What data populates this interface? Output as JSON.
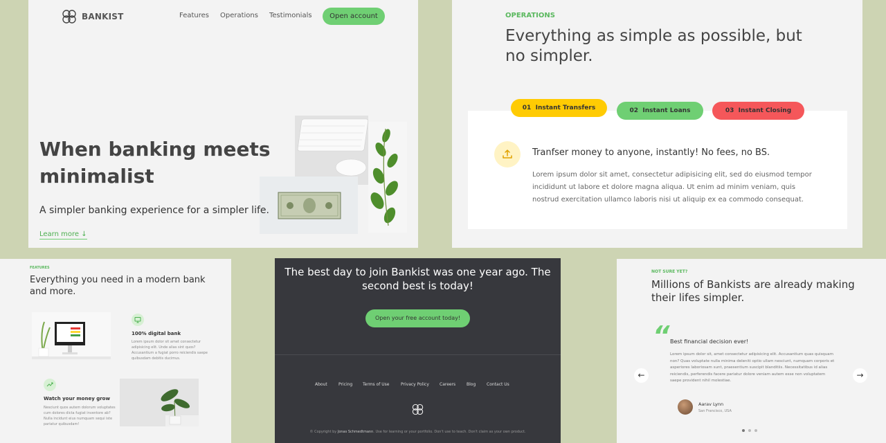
{
  "colors": {
    "background": "#cdd4b3",
    "panel": "#f3f3f3",
    "accent_green": "#6fcf73",
    "dark": "#37383d",
    "tab_yellow": "#ffcb03",
    "tab_green": "#6fcf73",
    "tab_red": "#f5575a"
  },
  "hero": {
    "brand": "BANKIST",
    "nav": [
      "Features",
      "Operations",
      "Testimonials"
    ],
    "cta": "Open account",
    "headline_word1": "When",
    "headline_highlight1": "banking",
    "headline_word2": "meets",
    "headline_highlight2": "minimalist",
    "subtitle": "A simpler banking experience for a simpler life.",
    "learn_more": "Learn more ↓"
  },
  "operations": {
    "label": "OPERATIONS",
    "title": "Everything as simple as possible, but no simpler.",
    "tabs": [
      {
        "num": "01",
        "label": "Instant Transfers"
      },
      {
        "num": "02",
        "label": "Instant Loans"
      },
      {
        "num": "03",
        "label": "Instant Closing"
      }
    ],
    "active_tab": "Instant Transfers",
    "heading": "Tranfser money to anyone, instantly! No fees, no BS.",
    "body": "Lorem ipsum dolor sit amet, consectetur adipisicing elit, sed do eiusmod tempor incididunt ut labore et dolore magna aliqua. Ut enim ad minim veniam, quis nostrud exercitation ullamco laboris nisi ut aliquip ex ea commodo consequat."
  },
  "features": {
    "label": "FEATURES",
    "title": "Everything you need in a modern bank and more.",
    "items": [
      {
        "title": "100% digital bank",
        "text": "Lorem ipsum dolor sit amet consectetur adipisicing elit. Unde alias sint quos? Accusantium a fugiat porro reiciendis saepe quibusdam debitis ducimus."
      },
      {
        "title": "Watch your money grow",
        "text": "Nesciunt quos autem dolorum voluptates cum dolores dicta fugiat inventore ab? Nulla incidunt eius numquam sequi iste pariatur quibusdam!"
      }
    ]
  },
  "signup": {
    "title": "The best day to join Bankist was one year ago. The second best is today!",
    "cta": "Open your free account today!",
    "footer_nav": [
      "About",
      "Pricing",
      "Terms of Use",
      "Privacy Policy",
      "Careers",
      "Blog",
      "Contact Us"
    ],
    "copyright_prefix": "© Copyright by",
    "copyright_author": "Jonas Schmedtmann",
    "copyright_suffix": ". Use for learning or your portfolio. Don't use to teach. Don't claim as your own product."
  },
  "testimonials": {
    "label": "NOT SURE YET?",
    "title": "Millions of Bankists are already making their lifes simpler.",
    "quote_mark": "“",
    "heading": "Best financial decision ever!",
    "body": "Lorem ipsum dolor sit, amet consectetur adipisicing elit. Accusantium quas quisquam non? Quas voluptate nulla minima deleniti optio ullam nesciunt, numquam corporis et asperiores laboriosam sunt, praesentium suscipit blanditiis. Necessitatibus id alias reiciendis, perferendis facere pariatur dolore veniam autem esse non voluptatem saepe provident nihil molestiae.",
    "name": "Aarav Lynn",
    "location": "San Francisco, USA",
    "prev": "←",
    "next": "→"
  }
}
